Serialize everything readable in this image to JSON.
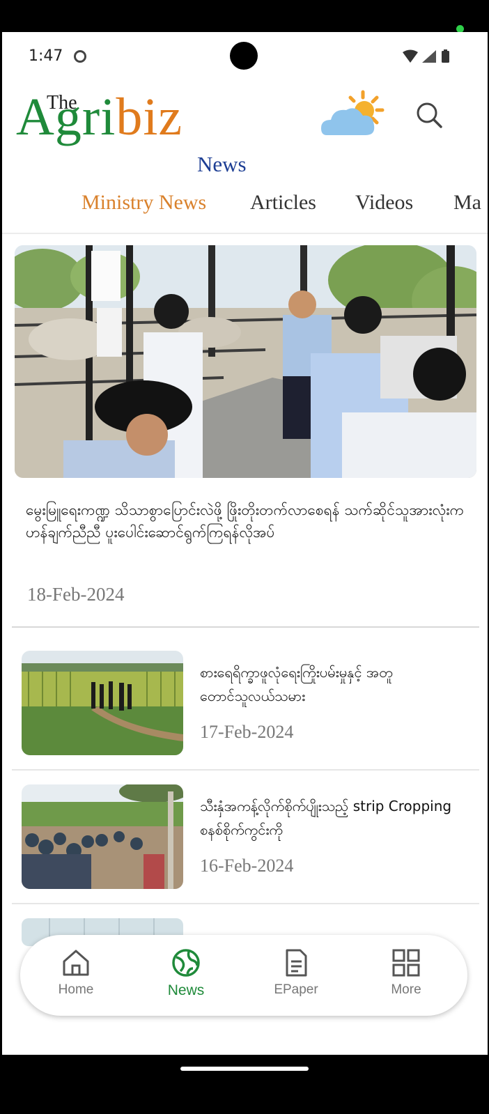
{
  "status_bar": {
    "time": "1:47"
  },
  "header": {
    "logo_the": "The",
    "logo_agri": "Agri",
    "logo_biz": "biz",
    "logo_news": "News"
  },
  "tabs": [
    {
      "label": "Ministry News",
      "active": true
    },
    {
      "label": "Articles",
      "active": false
    },
    {
      "label": "Videos",
      "active": false
    },
    {
      "label": "Ma",
      "active": false
    }
  ],
  "featured": {
    "title": "မွေးမြူရေးကဏ္ဍ သိသာစွာပြောင်းလဲဖို့ ဖြိုးတိုးတက်လာစေရန် သက်ဆိုင်သူအားလုံးက ဟန်ချက်ညီညီ ပူးပေါင်းဆောင်ရွက်ကြရန်လိုအပ်",
    "date": "18-Feb-2024"
  },
  "articles": [
    {
      "title": "စားရေရိက္ခာဖူလုံရေးကြိုးပမ်းမှုနှင့် အတူ တောင်သူလယ်သမား",
      "date": "17-Feb-2024"
    },
    {
      "title": "သီးနှံအကန့်လိုက်စိုက်ပျိုးသည့် strip Cropping စနစ်စိုက်ကွင်းကို",
      "date": "16-Feb-2024"
    }
  ],
  "bottom_nav": [
    {
      "label": "Home",
      "icon": "home-icon",
      "active": false
    },
    {
      "label": "News",
      "icon": "globe-icon",
      "active": true
    },
    {
      "label": "EPaper",
      "icon": "document-icon",
      "active": false
    },
    {
      "label": "More",
      "icon": "grid-icon",
      "active": false
    }
  ],
  "colors": {
    "accent_orange": "#d9812c",
    "brand_green": "#1f8a3a",
    "brand_blue": "#1d3e94"
  }
}
